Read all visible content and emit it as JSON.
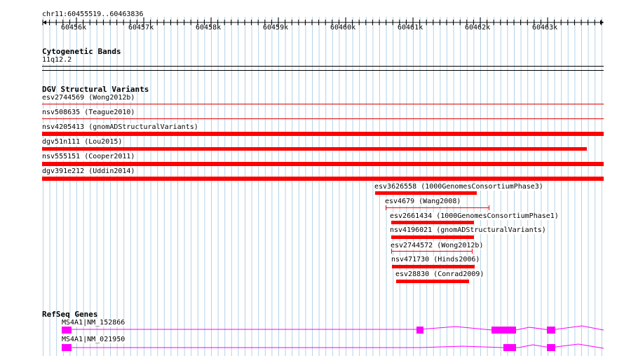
{
  "ruler": {
    "range_label": "chr11:60455519..60463836",
    "ticks": [
      "60456k",
      "60457k",
      "60458k",
      "60459k",
      "60460k",
      "60461k",
      "60462k",
      "60463k"
    ]
  },
  "tracks": {
    "cytoband": {
      "title": "Cytogenetic Bands",
      "band": "11q12.2"
    },
    "dgv": {
      "title": "DGV Structural Variants",
      "features": [
        {
          "label": "esv2744569 (Wong2012b)",
          "color": "#e00000",
          "style": "thin"
        },
        {
          "label": "nsv508635 (Teague2010)",
          "color": "#e00000",
          "style": "thin"
        },
        {
          "label": "nsv4205413 (gnomADStructuralVariants)",
          "color": "#ff0000",
          "style": "bar"
        },
        {
          "label": "dgv51n111 (Lou2015)",
          "color": "#ff0000",
          "style": "bar"
        },
        {
          "label": "nsv555151 (Cooper2011)",
          "color": "#ff0000",
          "style": "bar"
        },
        {
          "label": "dgv391e212 (Uddin2014)",
          "color": "#ff0000",
          "style": "bar"
        },
        {
          "label": "esv3626558 (1000GenomesConsortiumPhase3)",
          "color": "#ff0000",
          "style": "bar"
        },
        {
          "label": "esv4679 (Wang2008)",
          "color": "#ff0000",
          "style": "interval"
        },
        {
          "label": "esv2661434 (1000GenomesConsortiumPhase1)",
          "color": "#ff0000",
          "style": "bar"
        },
        {
          "label": "nsv4196021 (gnomADStructuralVariants)",
          "color": "#ff0000",
          "style": "bar"
        },
        {
          "label": "esv2744572 (Wong2012b)",
          "color": "#ff0000",
          "style": "interval"
        },
        {
          "label": "nsv471730 (Hinds2006)",
          "color": "#ff0000",
          "style": "bar"
        },
        {
          "label": "esv28830 (Conrad2009)",
          "color": "#ff0000",
          "style": "bar"
        }
      ]
    },
    "refseq": {
      "title": "RefSeq Genes",
      "color": "#ff00ff",
      "transcripts": [
        {
          "label": "MS4A1|NM_152866"
        },
        {
          "label": "MS4A1|NM_021950"
        }
      ]
    }
  }
}
